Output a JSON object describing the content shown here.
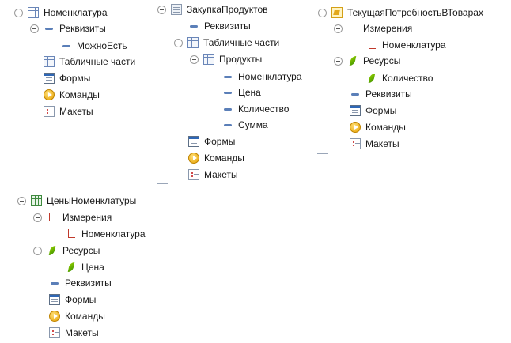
{
  "panels": {
    "nomenclature": {
      "title": "Номенклатура",
      "requisites": "Реквизиты",
      "requisite_item": "МожноЕсть",
      "tabular_parts": "Табличные части",
      "forms": "Формы",
      "commands": "Команды",
      "layouts": "Макеты"
    },
    "purchase": {
      "title": "ЗакупкаПродуктов",
      "requisites": "Реквизиты",
      "tabular_parts": "Табличные части",
      "products": "Продукты",
      "cols": [
        "Номенклатура",
        "Цена",
        "Количество",
        "Сумма"
      ],
      "forms": "Формы",
      "commands": "Команды",
      "layouts": "Макеты"
    },
    "need": {
      "title": "ТекущаяПотребностьВТоварах",
      "dimensions": "Измерения",
      "dimension_item": "Номенклатура",
      "resources": "Ресурсы",
      "resource_item": "Количество",
      "requisites": "Реквизиты",
      "forms": "Формы",
      "commands": "Команды",
      "layouts": "Макеты"
    },
    "prices": {
      "title": "ЦеныНоменклатуры",
      "dimensions": "Измерения",
      "dimension_item": "Номенклатура",
      "resources": "Ресурсы",
      "resource_item": "Цена",
      "requisites": "Реквизиты",
      "forms": "Формы",
      "commands": "Команды",
      "layouts": "Макеты"
    }
  }
}
